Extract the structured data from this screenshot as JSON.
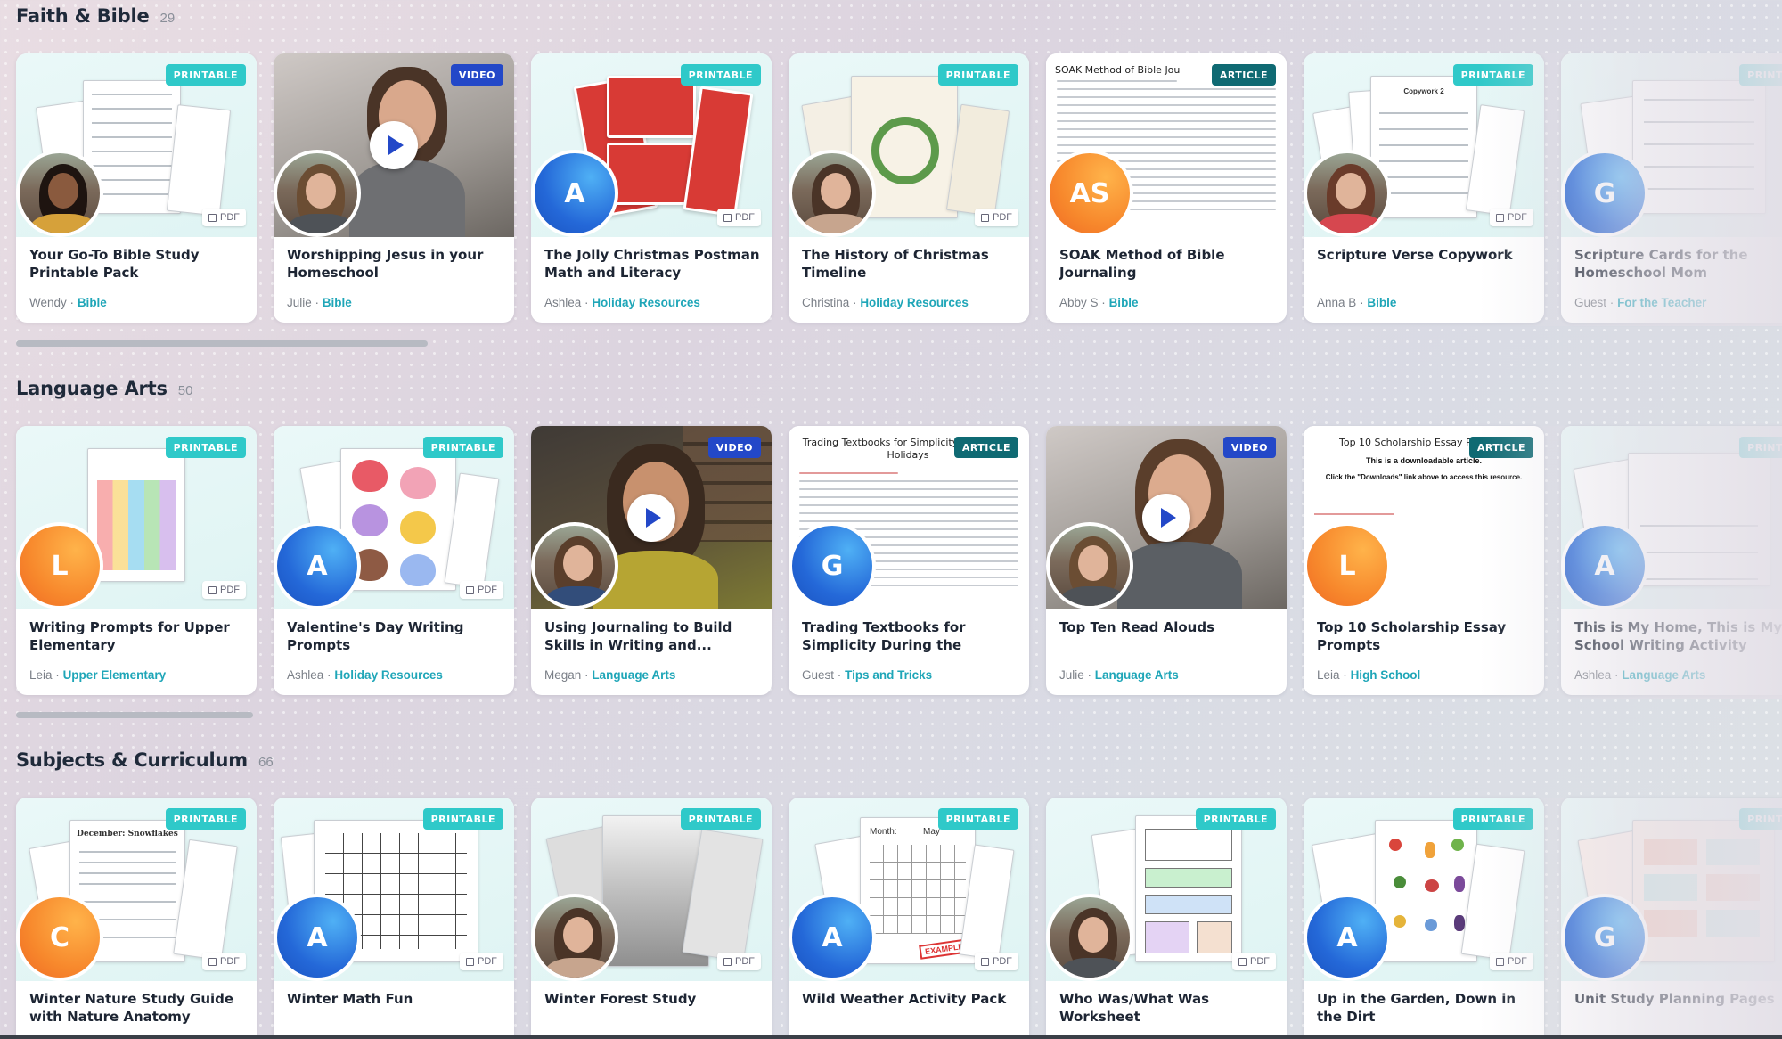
{
  "sections": [
    {
      "title": "Faith & Bible",
      "count": "29",
      "cards": [
        {
          "badge": "PRINTABLE",
          "pdf": "PDF",
          "title": "Your Go-To Bible Study Printable Pack",
          "author": "Wendy",
          "category": "Bible"
        },
        {
          "badge": "VIDEO",
          "title": "Worshipping Jesus in your Homeschool",
          "author": "Julie",
          "category": "Bible"
        },
        {
          "badge": "PRINTABLE",
          "pdf": "PDF",
          "avatar": "A",
          "title": "The Jolly Christmas Postman Math and Literacy Activities...",
          "author": "Ashlea",
          "category": "Holiday Resources"
        },
        {
          "badge": "PRINTABLE",
          "pdf": "PDF",
          "title": "The History of Christmas Timeline",
          "author": "Christina",
          "category": "Holiday Resources"
        },
        {
          "badge": "ARTICLE",
          "thumb_title": "SOAK Method of Bible Jou",
          "avatar": "AS",
          "title": "SOAK Method of Bible Journaling",
          "author": "Abby S",
          "category": "Bible"
        },
        {
          "badge": "PRINTABLE",
          "pdf": "PDF",
          "thumb_title": "Copywork 2",
          "title": "Scripture Verse Copywork",
          "author": "Anna B",
          "category": "Bible"
        },
        {
          "badge": "PRINT",
          "avatar": "G",
          "title": "Scripture Cards for the Homeschool Mom",
          "author": "Guest",
          "category": "For the Teacher"
        }
      ]
    },
    {
      "title": "Language Arts",
      "count": "50",
      "cards": [
        {
          "badge": "PRINTABLE",
          "pdf": "PDF",
          "avatar": "L",
          "title": "Writing Prompts for Upper Elementary",
          "author": "Leia",
          "category": "Upper Elementary"
        },
        {
          "badge": "PRINTABLE",
          "pdf": "PDF",
          "avatar": "A",
          "title": "Valentine's Day Writing Prompts",
          "author": "Ashlea",
          "category": "Holiday Resources"
        },
        {
          "badge": "VIDEO",
          "title": "Using Journaling to Build Skills in Writing and...",
          "author": "Megan",
          "category": "Language Arts"
        },
        {
          "badge": "ARTICLE",
          "thumb_title": "Trading Textbooks for Simplicity During the Holidays",
          "avatar": "G",
          "title": "Trading Textbooks for Simplicity During the Holidays",
          "author": "Guest",
          "category": "Tips and Tricks"
        },
        {
          "badge": "VIDEO",
          "title": "Top Ten Read Alouds",
          "author": "Julie",
          "category": "Language Arts"
        },
        {
          "badge": "ARTICLE",
          "thumb_title": "Top 10 Scholarship Essay P",
          "thumb_sub": "This is a downloadable article.",
          "thumb_sub2": "Click the \"Downloads\" link above to access this resource.",
          "avatar": "L",
          "title": "Top 10 Scholarship Essay Prompts",
          "author": "Leia",
          "category": "High School"
        },
        {
          "badge": "PRINT",
          "avatar": "A",
          "title": "This is My Home, This is My School Writing Activity",
          "author": "Ashlea",
          "category": "Language Arts"
        }
      ]
    },
    {
      "title": "Subjects & Curriculum",
      "count": "66",
      "cards": [
        {
          "badge": "PRINTABLE",
          "pdf": "PDF",
          "thumb_title": "December: Snowflakes",
          "avatar": "C",
          "title": "Winter Nature Study Guide with Nature Anatomy",
          "author": "",
          "category": ""
        },
        {
          "badge": "PRINTABLE",
          "pdf": "PDF",
          "avatar": "A",
          "title": "Winter Math Fun",
          "author": "",
          "category": ""
        },
        {
          "badge": "PRINTABLE",
          "pdf": "PDF",
          "title": "Winter Forest Study",
          "author": "",
          "category": ""
        },
        {
          "badge": "PRINTABLE",
          "pdf": "PDF",
          "avatar": "A",
          "thumb_title": "Month:",
          "thumb_title2": "May",
          "stamp": "EXAMPLE",
          "title": "Wild Weather Activity Pack",
          "author": "",
          "category": ""
        },
        {
          "badge": "PRINTABLE",
          "pdf": "PDF",
          "title": "Who Was/What Was Worksheet",
          "author": "",
          "category": ""
        },
        {
          "badge": "PRINTABLE",
          "pdf": "PDF",
          "avatar": "A",
          "title": "Up in the Garden, Down in the Dirt",
          "author": "",
          "category": ""
        },
        {
          "badge": "PRINT",
          "avatar": "G",
          "title": "Unit Study Planning Pages",
          "author": "",
          "category": ""
        }
      ]
    }
  ],
  "separator": "·",
  "colors": {
    "printable": "#2fc9c9",
    "video": "#2348c8",
    "article": "#0f6a73",
    "category": "#1fa6b8"
  }
}
